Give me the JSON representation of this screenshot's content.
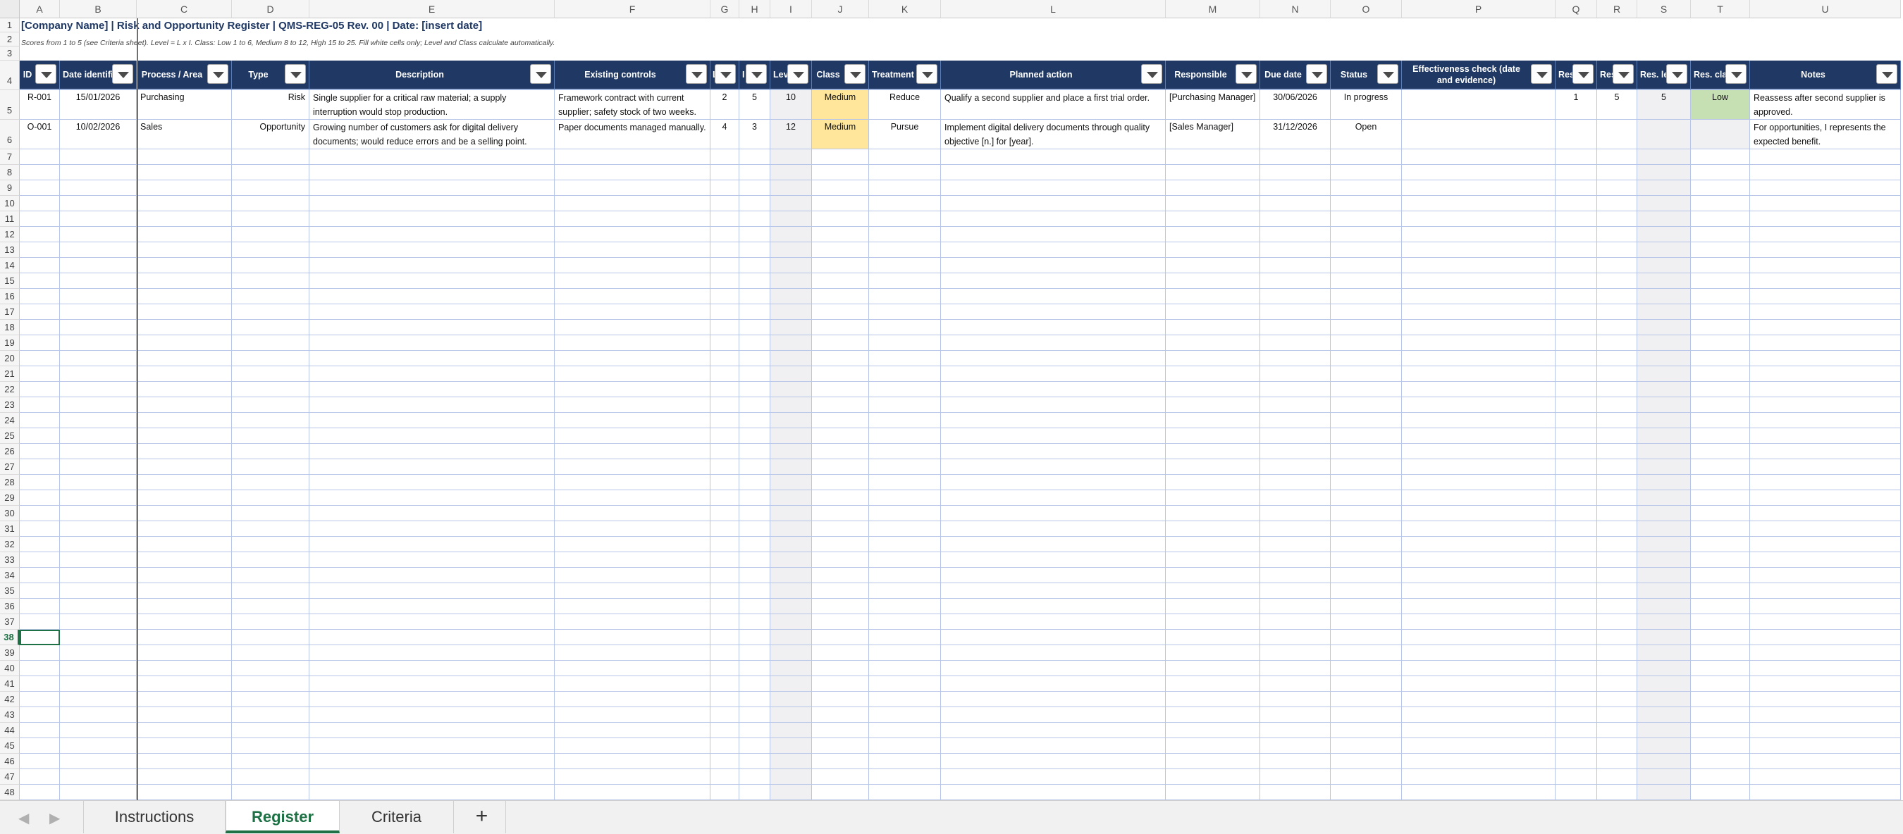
{
  "columns": [
    "A",
    "B",
    "C",
    "D",
    "E",
    "F",
    "G",
    "H",
    "I",
    "J",
    "K",
    "L",
    "M",
    "N",
    "O",
    "P",
    "Q",
    "R",
    "S",
    "T",
    "U"
  ],
  "row_numbers": [
    "1",
    "2",
    "3",
    "4",
    "5",
    "6",
    "7",
    "8",
    "9",
    "10",
    "11",
    "12",
    "13",
    "14",
    "15",
    "16",
    "17",
    "18",
    "19",
    "20",
    "21",
    "22",
    "23",
    "24",
    "25",
    "26",
    "27",
    "28",
    "29",
    "30",
    "31",
    "32",
    "33",
    "34",
    "35",
    "36",
    "37",
    "38",
    "39",
    "40",
    "41",
    "42",
    "43",
    "44",
    "45",
    "46",
    "47",
    "48"
  ],
  "selected_row": "38",
  "sheet_title": "[Company Name] | Risk and Opportunity Register | QMS-REG-05 Rev. 00 | Date: [insert date]",
  "sheet_subtitle": "Scores from 1 to 5 (see Criteria sheet). Level = L x I. Class: Low 1 to 6, Medium 8 to 12, High 15 to 25. Fill white cells only; Level and Class calculate automatically.",
  "headers": [
    "ID",
    "Date identified",
    "Process / Area",
    "Type",
    "Description",
    "Existing controls",
    "L",
    "I",
    "Level",
    "Class",
    "Treatment",
    "Planned action",
    "Responsible",
    "Due date",
    "Status",
    "Effectiveness check (date and evidence)",
    "Res. L",
    "Res. I",
    "Res. level",
    "Res. class",
    "Notes"
  ],
  "rows": [
    [
      "R-001",
      "15/01/2026",
      "Purchasing",
      "Risk",
      "Single supplier for a critical raw material; a supply interruption would stop production.",
      "Framework contract with current supplier; safety stock of two weeks.",
      "2",
      "5",
      "10",
      "Medium",
      "Reduce",
      "Qualify a second supplier and place a first trial order.",
      "[Purchasing Manager]",
      "30/06/2026",
      "In progress",
      "",
      "1",
      "5",
      "5",
      "Low",
      "Reassess after second supplier is approved."
    ],
    [
      "O-001",
      "10/02/2026",
      "Sales",
      "Opportunity",
      "Growing number of customers ask for digital delivery documents; would reduce errors and be a selling point.",
      "Paper documents managed manually.",
      "4",
      "3",
      "12",
      "Medium",
      "Pursue",
      "Implement digital delivery documents through quality objective [n.] for [year].",
      "[Sales Manager]",
      "31/12/2026",
      "Open",
      "",
      "",
      "",
      "",
      "",
      "For opportunities, I represents the expected benefit."
    ]
  ],
  "tabs": [
    "Instructions",
    "Register",
    "Criteria"
  ],
  "active_tab": "Register",
  "add_tab_label": "+",
  "nav_prev": "◀",
  "nav_next": "▶",
  "colors": {
    "header_bg": "#1f3864",
    "medium_class": "#ffe69a",
    "low_class": "#c6e0b4",
    "calculated_cell": "#f0f0f2",
    "active_tab_accent": "#1e7145"
  }
}
